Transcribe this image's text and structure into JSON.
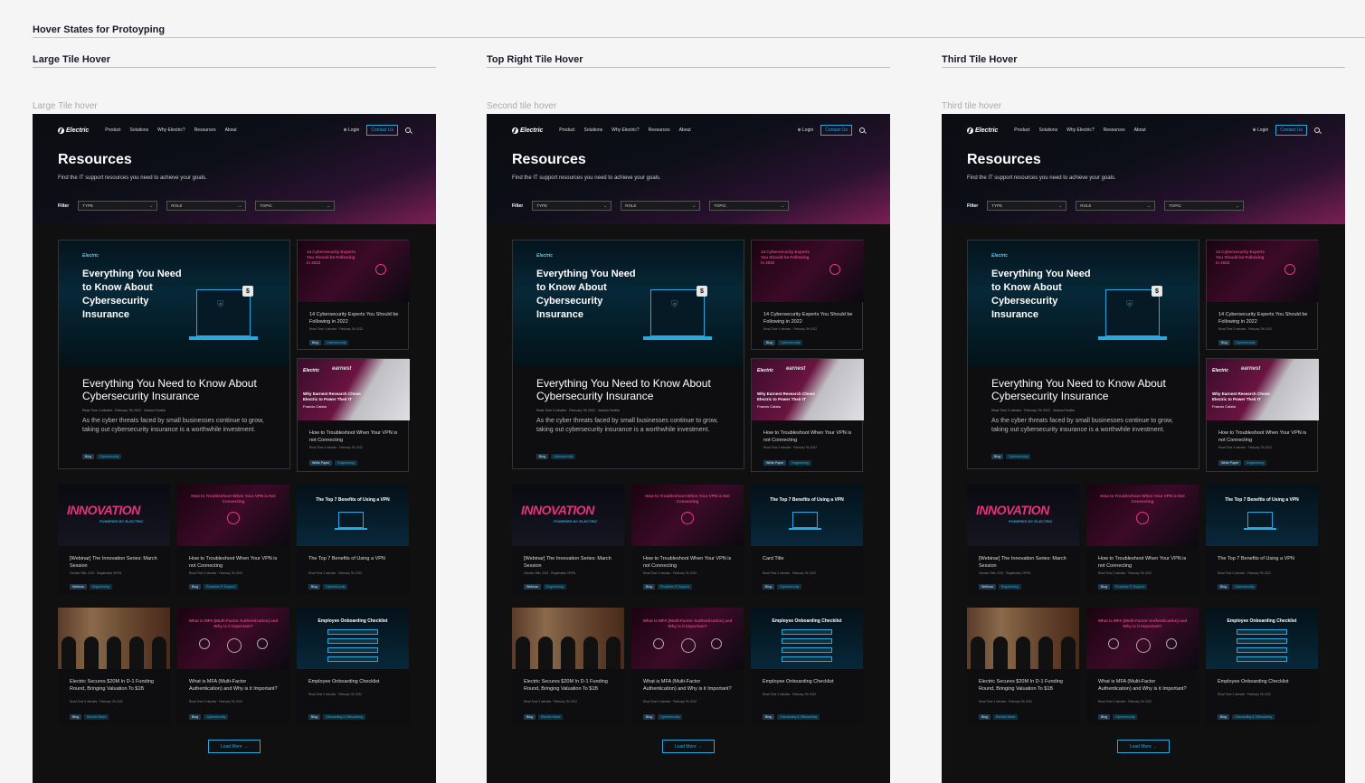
{
  "page": {
    "title": "Hover States for Protoyping"
  },
  "columns": [
    {
      "heading": "Large Tile Hover",
      "sublabel": "Large Tile hover"
    },
    {
      "heading": "Top Right Tile Hover",
      "sublabel": "Second tile hover"
    },
    {
      "heading": "Third Tile Hover",
      "sublabel": "Third tile hover"
    }
  ],
  "site": {
    "logo": "Electric",
    "nav": [
      "Product",
      "Solutions",
      "Why Electric?",
      "Resources",
      "About"
    ],
    "login": "Login",
    "contact": "Contact Us",
    "heading": "Resources",
    "subheading": "Find the IT support resources you need to achieve your goals.",
    "filter_label": "Filter",
    "filters": [
      "TYPE",
      "ROLE",
      "TOPIC"
    ],
    "load_more": "Load More →"
  },
  "big_card": {
    "img_title": "Everything You Need to Know About Cybersecurity Insurance",
    "title": "Everything You Need to Know About Cybersecurity Insurance",
    "meta": "Read Time 3 minutes · February 7th 2022 · Jessica Familia",
    "desc": "As the cyber threats faced by small businesses continue to grow, taking out cybersecurity insurance is a worthwhile investment.",
    "tags": [
      "Blog",
      "Cybersecurity"
    ]
  },
  "cards": {
    "c1": {
      "img_title": "14 Cybersecurity Experts You Should be Following in 2022",
      "title": "14 Cybersecurity Experts You Should be Following in 2022",
      "meta": "Read Time 3 minutes · February 7th 2022",
      "tags": [
        "Blog",
        "Cybersecurity"
      ]
    },
    "c2": {
      "img_title": "Why Earnest Research Chose Electric to Power Their IT",
      "brand": "earnest",
      "person": "Francis Calata",
      "title": "How to Troubleshoot When Your VPN is not Connecting",
      "meta": "Read Time 3 minutes · February 7th 2022",
      "tags": [
        "White Paper",
        "Engineering"
      ]
    },
    "c3": {
      "img_title": "INNOVATION",
      "img_sub": "POWERED BY ELECTRIC",
      "title": "[Webinar] The Innovation Series: March Session",
      "meta": "October 28th, 2022 · Registration OPEN",
      "tags": [
        "Webinar",
        "Engineering"
      ]
    },
    "c4": {
      "img_title": "How to Troubleshoot When Your VPN is Not Connecting",
      "title": "How to Troubleshoot When Your VPN is not Connecting",
      "meta": "Read Time 3 minutes · February 7th 2022",
      "tags": [
        "Blog",
        "Proactive IT Support"
      ]
    },
    "c5": {
      "img_title": "The Top 7 Benefits of Using a VPN",
      "title": "The Top 7 Benefits of Using a VPN",
      "title_alt": "Card Title",
      "meta": "Read Time 3 minutes · February 7th 2022",
      "tags": [
        "Blog",
        "Cybersecurity"
      ]
    },
    "c6": {
      "title": "Electric Secures $20M In D-1 Funding Round, Bringing Valuation To $1B",
      "meta": "Read Time 3 minutes · February 7th 2022",
      "tags": [
        "Blog",
        "Electric News"
      ]
    },
    "c7": {
      "img_title": "What is MFA (Multi-Factor Authentication) and Why is it Important?",
      "title": "What is MFA (Multi-Factor Authentication) and Why is it Important?",
      "meta": "Read Time 3 minutes · February 7th 2022",
      "tags": [
        "Blog",
        "Cybersecurity"
      ]
    },
    "c8": {
      "img_title": "Employee Onboarding Checklist",
      "title": "Employee Onboarding Checklist",
      "meta": "Read Time 3 minutes · February 7th 2022",
      "tags": [
        "Blog",
        "Onboarding & Offboarding"
      ]
    }
  }
}
